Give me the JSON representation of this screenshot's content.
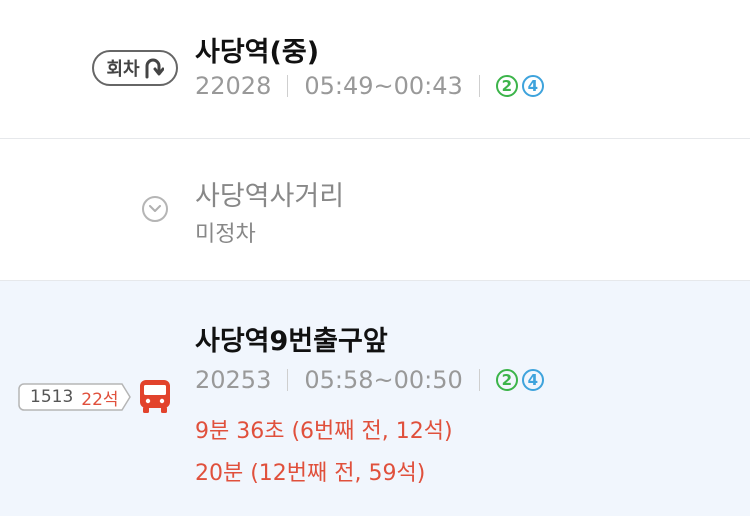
{
  "stops": [
    {
      "name": "사당역(중)",
      "id": "22028",
      "hours": "05:49~00:43",
      "lines": [
        {
          "label": "2",
          "color": "#3cb44a"
        },
        {
          "label": "4",
          "color": "#3ea3dc"
        }
      ],
      "badge": "회차"
    },
    {
      "name": "사당역사거리",
      "status": "미정차"
    },
    {
      "name": "사당역9번출구앞",
      "id": "20253",
      "hours": "05:58~00:50",
      "lines": [
        {
          "label": "2",
          "color": "#3cb44a"
        },
        {
          "label": "4",
          "color": "#3ea3dc"
        }
      ],
      "arrivals": [
        "9분 36초 (6번째 전, 12석)",
        "20분 (12번째 전, 59석)"
      ]
    }
  ],
  "bus": {
    "number": "1513",
    "seats": "22석"
  },
  "colors": {
    "route_line": "#f2c23c",
    "route_line_passed": "#a8a8a8",
    "arrival_text": "#e0503c",
    "bus_icon": "#e2432c",
    "highlight_bg": "#f1f6fd"
  },
  "icons": {
    "turn": "u-turn-icon",
    "not_stopping": "chevron-down-icon",
    "bus": "bus-icon"
  }
}
